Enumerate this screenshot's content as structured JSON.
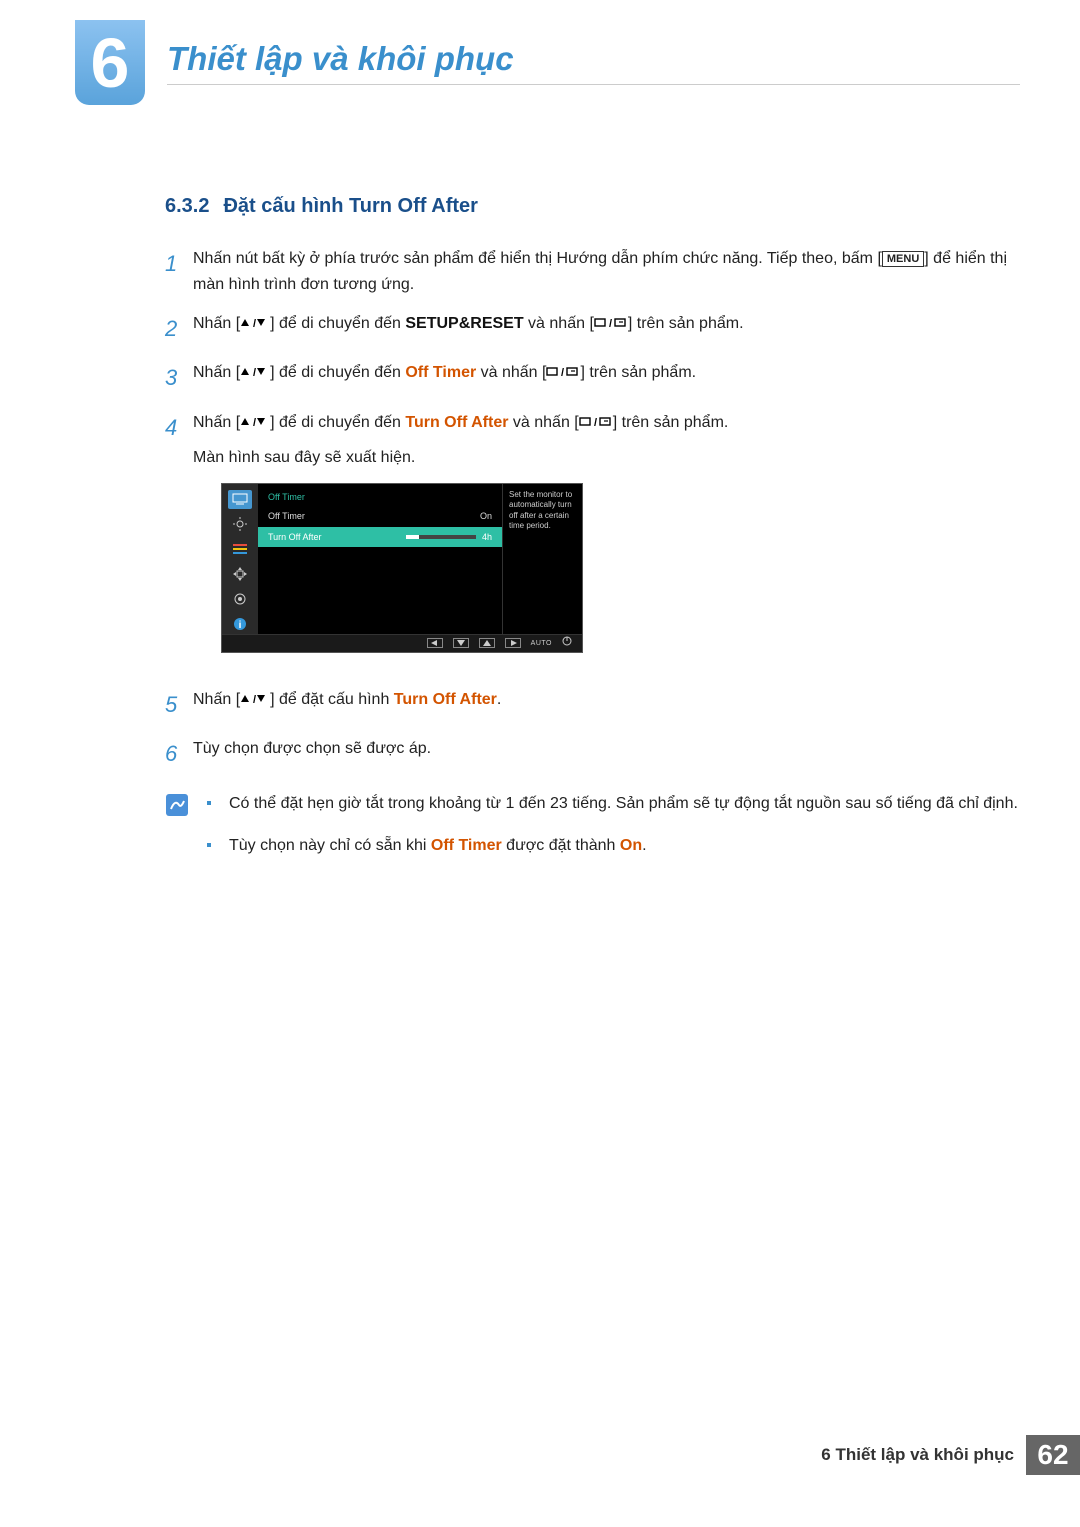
{
  "chapter": {
    "number": "6",
    "title": "Thiết lập và khôi phục"
  },
  "section": {
    "number": "6.3.2",
    "title": "Đặt cấu hình Turn Off After"
  },
  "steps": {
    "s1a": "Nhấn nút bất kỳ ở phía trước sản phẩm để hiển thị Hướng dẫn phím chức năng. Tiếp theo, bấm [",
    "menu": "MENU",
    "s1b": "] để hiển thị màn hình trình đơn tương ứng.",
    "s2a": "Nhấn [",
    "s2b": "] để di chuyển đến ",
    "setup_reset": "SETUP&RESET",
    "s2c": " và nhấn [",
    "s2d": "] trên sản phẩm.",
    "s3a": "Nhấn [",
    "s3b": "] để di chuyển đến ",
    "off_timer": "Off Timer",
    "s3c": " và nhấn [",
    "s3d": "] trên sản phẩm.",
    "s4a": "Nhấn [",
    "s4b": "] để di chuyển đến ",
    "turn_off_after": "Turn Off After",
    "s4c": " và nhấn [",
    "s4d": "] trên sản phẩm.",
    "s4e": "Màn hình sau đây sẽ xuất hiện.",
    "s5a": "Nhấn [",
    "s5b": "] để đặt cấu hình ",
    "s5c": ".",
    "s6": "Tùy chọn được chọn sẽ được áp."
  },
  "osd": {
    "title": "Off Timer",
    "row1_label": "Off Timer",
    "row1_value": "On",
    "row2_label": "Turn Off After",
    "row2_value": "4h",
    "help": "Set the monitor to automatically turn off after a certain time period.",
    "auto": "AUTO"
  },
  "notes": {
    "n1": "Có thể đặt hẹn giờ tắt trong khoảng từ 1 đến 23 tiếng. Sản phẩm sẽ tự động tắt nguồn sau số tiếng đã chỉ định.",
    "n2a": "Tùy chọn này chỉ có sẵn khi ",
    "n2_off_timer": "Off Timer",
    "n2b": " được đặt thành ",
    "n2_on": "On",
    "n2c": "."
  },
  "footer": {
    "label": "6 Thiết lập và khôi phục",
    "page": "62"
  }
}
